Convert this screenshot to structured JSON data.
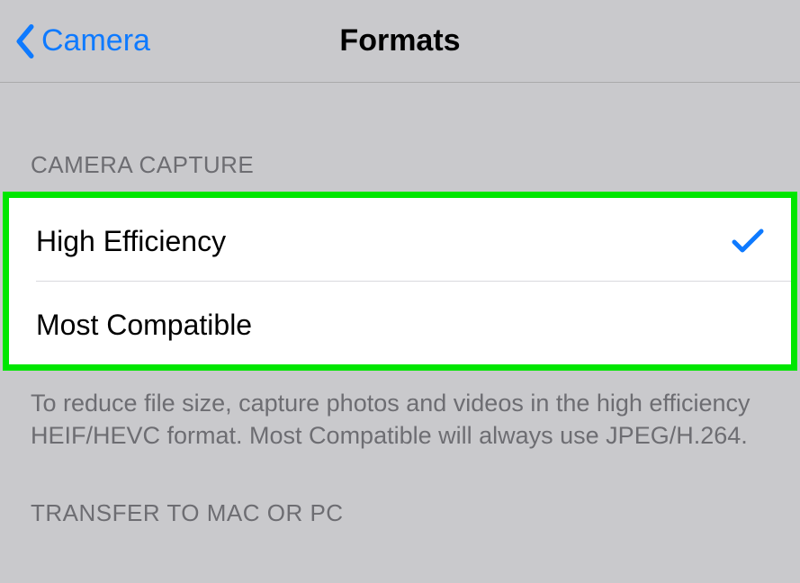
{
  "nav": {
    "back_label": "Camera",
    "title": "Formats"
  },
  "sections": {
    "capture": {
      "header": "CAMERA CAPTURE",
      "options": {
        "high_efficiency": "High Efficiency",
        "most_compatible": "Most Compatible"
      },
      "footer": "To reduce file size, capture photos and videos in the high efficiency HEIF/HEVC format. Most Compatible will always use JPEG/H.264."
    },
    "transfer": {
      "header": "TRANSFER TO MAC OR PC"
    }
  },
  "selected": "high_efficiency"
}
